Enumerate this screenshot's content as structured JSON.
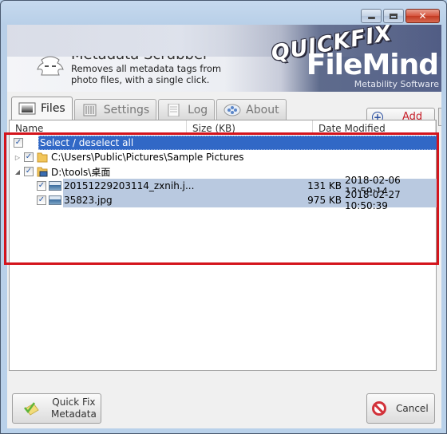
{
  "window": {
    "controls": {
      "minimize": "minimize",
      "maximize": "maximize",
      "close": "✕"
    }
  },
  "banner": {
    "app_name": "Metadata Scrubber",
    "app_description": "Removes all metadata tags from photo files, with a single click.",
    "brand_top": "QUICKFIX",
    "brand_main": "FileMind",
    "brand_sub": "Metability Software"
  },
  "tabs": [
    {
      "label": "Files",
      "icon": "files-icon",
      "active": true
    },
    {
      "label": "Settings",
      "icon": "settings-icon",
      "active": false
    },
    {
      "label": "Log",
      "icon": "log-icon",
      "active": false
    },
    {
      "label": "About",
      "icon": "about-icon",
      "active": false
    }
  ],
  "toolbar": {
    "add_label": "Add"
  },
  "file_list": {
    "columns": [
      "Name",
      "Size (KB)",
      "Date Modified"
    ],
    "select_all_label": "Select / deselect all",
    "folders": [
      {
        "path": "C:\\Users\\Public\\Pictures\\Sample Pictures",
        "expanded": false,
        "checked": true
      },
      {
        "path": "D:\\tools\\桌面",
        "expanded": true,
        "checked": true
      }
    ],
    "files": [
      {
        "name": "20151229203114_zxnih.j...",
        "size": "131 KB",
        "date": "2018-02-06 13:59:14",
        "checked": true
      },
      {
        "name": "35823.jpg",
        "size": "975 KB",
        "date": "2018-02-27 10:50:39",
        "checked": true
      }
    ]
  },
  "actions": {
    "quick_fix_line1": "Quick Fix",
    "quick_fix_line2": "Metadata",
    "cancel": "Cancel"
  },
  "glyphs": {
    "check": "✓",
    "collapsed": "▷",
    "expanded": "◢",
    "plus": "+"
  }
}
